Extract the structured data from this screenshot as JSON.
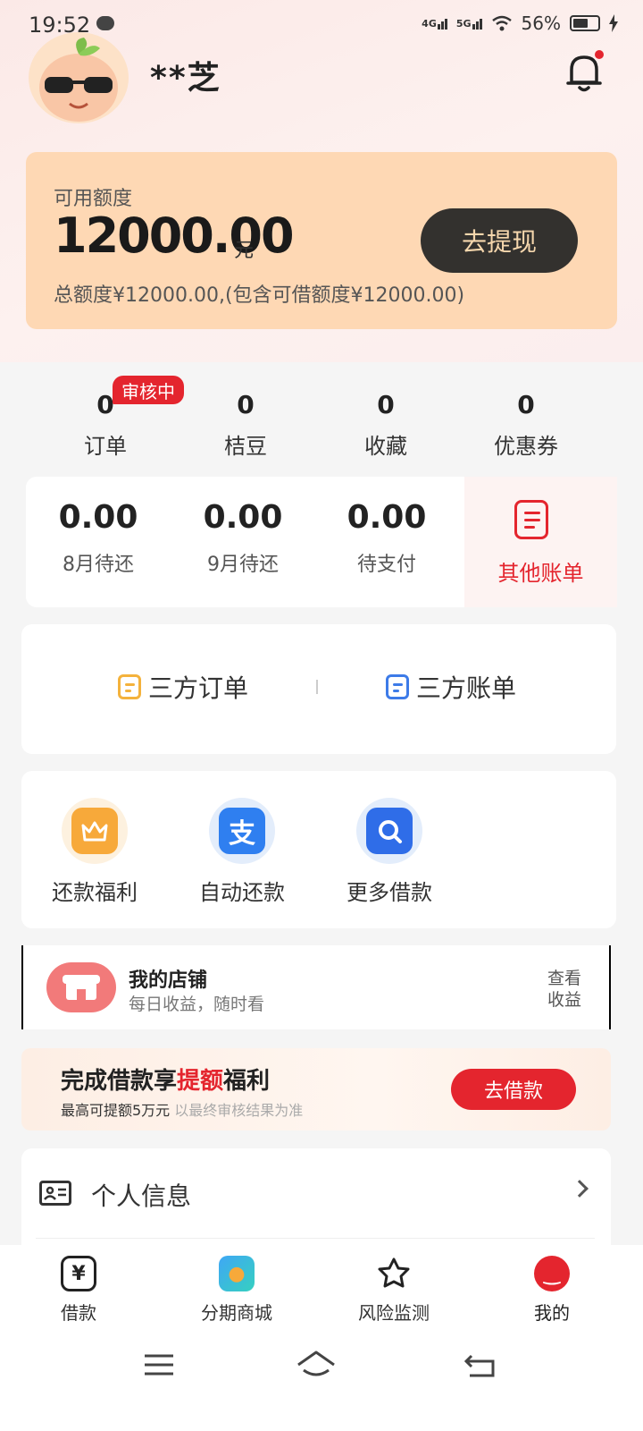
{
  "status_bar": {
    "time": "19:52",
    "network1": "4G",
    "network2": "5G",
    "battery": "56%"
  },
  "header": {
    "username": "**芝"
  },
  "credit": {
    "label": "可用额度",
    "amount": "12000.00",
    "unit": "元",
    "subtitle": "总额度¥12000.00,(包含可借额度¥12000.00)",
    "withdraw_label": "去提现"
  },
  "stats": [
    {
      "value": "0",
      "label": "订单"
    },
    {
      "value": "0",
      "label": "桔豆"
    },
    {
      "value": "0",
      "label": "收藏"
    },
    {
      "value": "0",
      "label": "优惠券"
    }
  ],
  "stats_badge": "审核中",
  "bills": [
    {
      "amount": "0.00",
      "label": "8月待还"
    },
    {
      "amount": "0.00",
      "label": "9月待还"
    },
    {
      "amount": "0.00",
      "label": "待支付"
    }
  ],
  "other_bills_label": "其他账单",
  "third_party": {
    "orders_label": "三方订单",
    "bills_label": "三方账单"
  },
  "services": [
    {
      "label": "还款福利"
    },
    {
      "label": "自动还款"
    },
    {
      "label": "更多借款"
    }
  ],
  "shop": {
    "title": "我的店铺",
    "subtitle": "每日收益，随时看",
    "link": "查看收益"
  },
  "promo": {
    "title_a": "完成借款享",
    "title_hl": "提额",
    "title_b": "福利",
    "sub_a": "最高可提额5万元",
    "sub_b": "以最终审核结果为准",
    "button": "去借款"
  },
  "personal_info": {
    "label": "个人信息"
  },
  "bottom_nav": [
    {
      "label": "借款"
    },
    {
      "label": "分期商城"
    },
    {
      "label": "风险监测"
    },
    {
      "label": "我的"
    }
  ],
  "colors": {
    "brand_red": "#e4252e",
    "card_orange": "#fed8b4",
    "button_dark": "#33312e"
  },
  "icons": [
    "chat-bubble-icon",
    "wifi-icon",
    "battery-icon",
    "bell-icon",
    "receipt-icon",
    "document-icon",
    "crown-icon",
    "alipay-icon",
    "search-icon",
    "shop-icon",
    "id-card-icon",
    "chevron-right-icon",
    "yuan-icon",
    "mall-icon",
    "shield-star-icon",
    "me-icon",
    "menu-icon",
    "home-icon",
    "back-icon"
  ]
}
